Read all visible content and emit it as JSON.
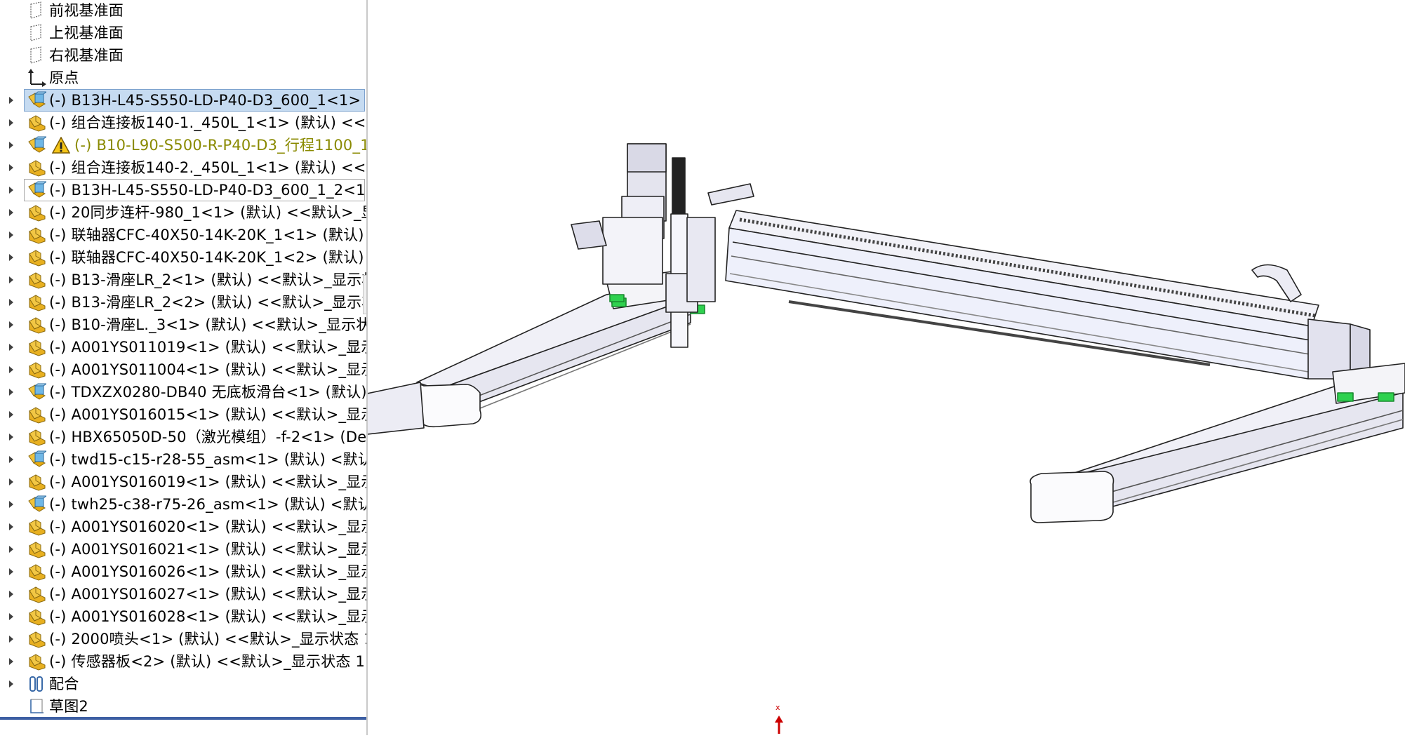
{
  "tree": {
    "items": [
      {
        "label": "前视基准面",
        "icon": "plane-icon",
        "expander": false
      },
      {
        "label": "上视基准面",
        "icon": "plane-icon",
        "expander": false
      },
      {
        "label": "右视基准面",
        "icon": "plane-icon",
        "expander": false
      },
      {
        "label": "原点",
        "icon": "origin-icon",
        "expander": false
      },
      {
        "label": "(-) B13H-L45-S550-LD-P40-D3_600_1<1>",
        "icon": "assembly-icon",
        "expander": true,
        "state": "selected"
      },
      {
        "label": "(-) 组合连接板140-1._450L_1<1> (默认) <<默",
        "icon": "part-icon",
        "expander": true
      },
      {
        "label": "(-) B10-L90-S500-R-P40-D3_行程1100_1",
        "icon": "assembly-icon",
        "expander": true,
        "warning": true
      },
      {
        "label": "(-) 组合连接板140-2._450L_1<1> (默认) <<默",
        "icon": "part-icon",
        "expander": true
      },
      {
        "label": "(-) B13H-L45-S550-LD-P40-D3_600_1_2<1",
        "icon": "assembly-icon",
        "expander": true,
        "state": "hovered"
      },
      {
        "label": "(-) 20同步连杆-980_1<1> (默认) <<默认>_显",
        "icon": "part-icon",
        "expander": true
      },
      {
        "label": "(-) 联轴器CFC-40X50-14K-20K_1<1> (默认)",
        "icon": "part-icon",
        "expander": true
      },
      {
        "label": "(-) 联轴器CFC-40X50-14K-20K_1<2> (默认)",
        "icon": "part-icon",
        "expander": true
      },
      {
        "label": "(-) B13-滑座LR_2<1> (默认) <<默认>_显示状",
        "icon": "part-icon",
        "expander": true
      },
      {
        "label": "(-) B13-滑座LR_2<2> (默认) <<默认>_显示状",
        "icon": "part-icon",
        "expander": true
      },
      {
        "label": "(-) B10-滑座L._3<1> (默认) <<默认>_显示状",
        "icon": "part-icon",
        "expander": true
      },
      {
        "label": "(-) A001YS011019<1> (默认) <<默认>_显示",
        "icon": "part-icon",
        "expander": true
      },
      {
        "label": "(-) A001YS011004<1> (默认) <<默认>_显示",
        "icon": "part-icon",
        "expander": true
      },
      {
        "label": "(-) TDXZX0280-DB40 无底板滑台<1> (默认)",
        "icon": "assembly-icon",
        "expander": true
      },
      {
        "label": "(-) A001YS016015<1> (默认) <<默认>_显示",
        "icon": "part-icon",
        "expander": true
      },
      {
        "label": "(-) HBX65050D-50（激光模组）-f-2<1> (De",
        "icon": "part-icon",
        "expander": true
      },
      {
        "label": "(-) twd15-c15-r28-55_asm<1> (默认) <默认",
        "icon": "assembly-icon",
        "expander": true
      },
      {
        "label": "(-) A001YS016019<1> (默认) <<默认>_显示",
        "icon": "part-icon",
        "expander": true
      },
      {
        "label": "(-) twh25-c38-r75-26_asm<1> (默认) <默认",
        "icon": "assembly-icon",
        "expander": true
      },
      {
        "label": "(-) A001YS016020<1> (默认) <<默认>_显示",
        "icon": "part-icon",
        "expander": true
      },
      {
        "label": "(-) A001YS016021<1> (默认) <<默认>_显示",
        "icon": "part-icon",
        "expander": true
      },
      {
        "label": "(-) A001YS016026<1> (默认) <<默认>_显示",
        "icon": "part-icon",
        "expander": true
      },
      {
        "label": "(-) A001YS016027<1> (默认) <<默认>_显示",
        "icon": "part-icon",
        "expander": true
      },
      {
        "label": "(-) A001YS016028<1> (默认) <<默认>_显示",
        "icon": "part-icon",
        "expander": true
      },
      {
        "label": "(-) 2000喷头<1> (默认) <<默认>_显示状态 1",
        "icon": "part-icon",
        "expander": true
      },
      {
        "label": "(-) 传感器板<2> (默认) <<默认>_显示状态 1",
        "icon": "part-icon",
        "expander": true
      },
      {
        "label": "配合",
        "icon": "mates-icon",
        "expander": true
      },
      {
        "label": "草图2",
        "icon": "sketch-icon",
        "expander": false
      }
    ]
  },
  "viewport": {
    "triad_label": "x",
    "colors": {
      "frame": "#e8e8f2",
      "edge": "#222222",
      "accent_green": "#29c24a",
      "triad": "#cc0000"
    }
  }
}
